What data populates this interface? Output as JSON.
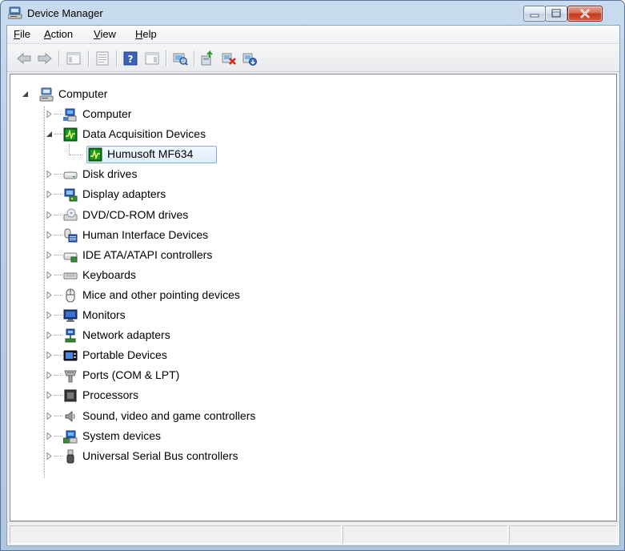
{
  "window": {
    "title": "Device Manager"
  },
  "menu": [
    {
      "label_pre": "",
      "label_u": "F",
      "label_post": "ile"
    },
    {
      "label_pre": "",
      "label_u": "A",
      "label_post": "ction"
    },
    {
      "label_pre": "",
      "label_u": "V",
      "label_post": "iew"
    },
    {
      "label_pre": "",
      "label_u": "H",
      "label_post": "elp"
    }
  ],
  "toolbar": {
    "icons": [
      "back-icon",
      "forward-icon",
      "show-hide-console-tree-icon",
      "properties-icon",
      "help-icon",
      "show-action-pane-icon",
      "scan-hardware-icon",
      "update-driver-icon",
      "uninstall-icon",
      "disable-icon"
    ]
  },
  "tree": {
    "root": "Computer",
    "categories": [
      {
        "label": "Computer",
        "icon": "computer-icon"
      },
      {
        "label": "Data Acquisition Devices",
        "icon": "data-acquisition-icon",
        "expanded": true,
        "children": [
          {
            "label": "Humusoft MF634",
            "icon": "data-acquisition-icon",
            "selected": true
          }
        ]
      },
      {
        "label": "Disk drives",
        "icon": "disk-drive-icon"
      },
      {
        "label": "Display adapters",
        "icon": "display-adapter-icon"
      },
      {
        "label": "DVD/CD-ROM drives",
        "icon": "dvd-drive-icon"
      },
      {
        "label": "Human Interface Devices",
        "icon": "hid-icon"
      },
      {
        "label": "IDE ATA/ATAPI controllers",
        "icon": "ide-controller-icon"
      },
      {
        "label": "Keyboards",
        "icon": "keyboard-icon"
      },
      {
        "label": "Mice and other pointing devices",
        "icon": "mouse-icon"
      },
      {
        "label": "Monitors",
        "icon": "monitor-icon"
      },
      {
        "label": "Network adapters",
        "icon": "network-adapter-icon"
      },
      {
        "label": "Portable Devices",
        "icon": "portable-device-icon"
      },
      {
        "label": "Ports (COM & LPT)",
        "icon": "port-icon"
      },
      {
        "label": "Processors",
        "icon": "processor-icon"
      },
      {
        "label": "Sound, video and game controllers",
        "icon": "sound-icon"
      },
      {
        "label": "System devices",
        "icon": "system-device-icon"
      },
      {
        "label": "Universal Serial Bus controllers",
        "icon": "usb-icon"
      }
    ]
  },
  "statusbar": {
    "panes": [
      "",
      "",
      ""
    ]
  }
}
